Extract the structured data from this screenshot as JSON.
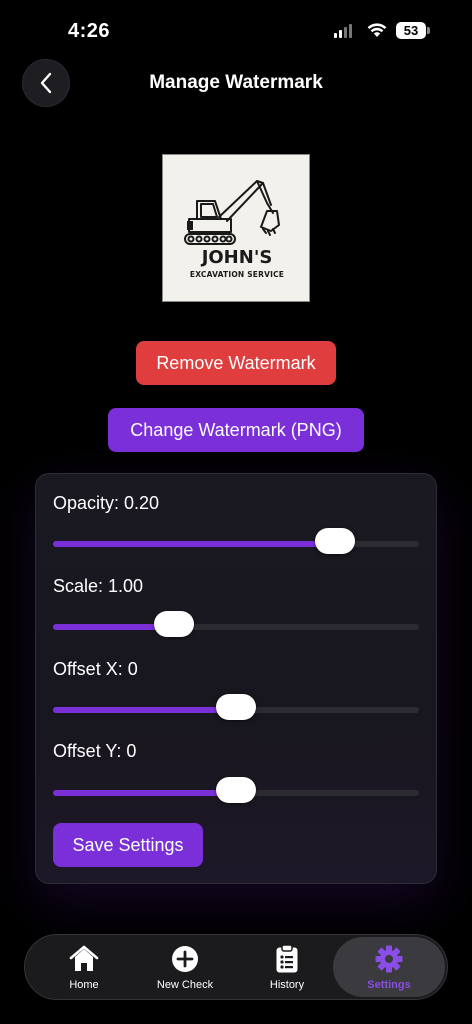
{
  "status_bar": {
    "time": "4:26",
    "battery": "53"
  },
  "header": {
    "title": "Manage Watermark"
  },
  "watermark": {
    "name": "JOHN'S",
    "subtitle": "EXCAVATION SERVICE"
  },
  "actions": {
    "remove_label": "Remove Watermark",
    "change_label": "Change Watermark (PNG)"
  },
  "settings": {
    "sliders": [
      {
        "label": "Opacity: 0.20",
        "level_percent": 77
      },
      {
        "label": "Scale: 1.00",
        "level_percent": 33
      },
      {
        "label": "Offset X: 0",
        "level_percent": 50
      },
      {
        "label": "Offset Y: 0",
        "level_percent": 50
      }
    ],
    "save_label": "Save Settings"
  },
  "tabs": [
    {
      "label": "Home",
      "icon": "home-icon",
      "active": false
    },
    {
      "label": "New Check",
      "icon": "plus-circle-icon",
      "active": false
    },
    {
      "label": "History",
      "icon": "clipboard-list-icon",
      "active": false
    },
    {
      "label": "Settings",
      "icon": "gear-icon",
      "active": true
    }
  ],
  "colors": {
    "accent": "#7a2fd8",
    "danger": "#e03e3e",
    "background": "#000000",
    "active_tab_text": "#8a4de6"
  }
}
